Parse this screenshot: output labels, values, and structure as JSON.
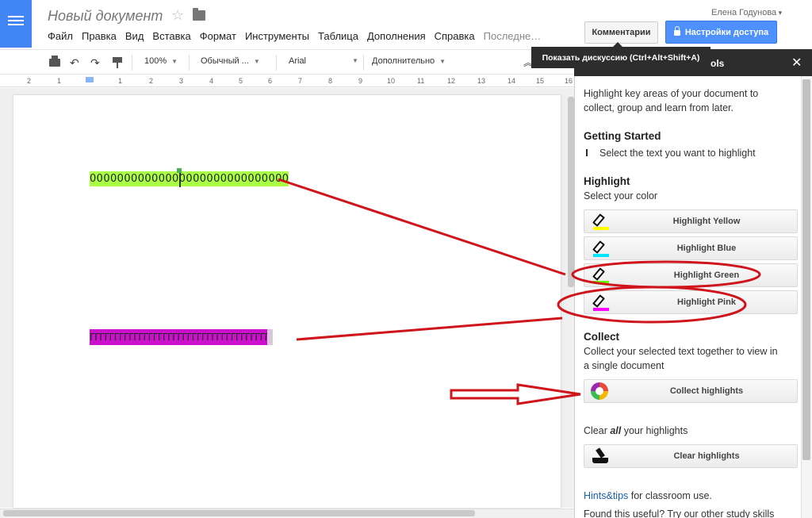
{
  "header": {
    "doc_title": "Новый документ",
    "user_name": "Елена Годунова",
    "comments_button": "Комментарии",
    "share_button": "Настройки доступа"
  },
  "menu": {
    "items": [
      "Файл",
      "Правка",
      "Вид",
      "Вставка",
      "Формат",
      "Инструменты",
      "Таблица",
      "Дополнения",
      "Справка"
    ],
    "recent": "Последне…"
  },
  "toolbar": {
    "zoom": "100%",
    "style": "Обычный ...",
    "font": "Arial",
    "more": "Дополнительно"
  },
  "ruler": {
    "ticks": [
      "2",
      "1",
      "1",
      "2",
      "3",
      "4",
      "5",
      "6",
      "7",
      "8",
      "9",
      "10",
      "11",
      "12",
      "13",
      "14",
      "15",
      "16"
    ]
  },
  "tooltip": {
    "text": "Показать дискуссию (Ctrl+Alt+Shift+A)"
  },
  "document": {
    "line1": "00000000000000000000000000000",
    "line2": "ГГГГГГГГГГГГГГГГГГГГГГГГГГГГГГГГГГГГГГГГГГГГ"
  },
  "sidebar": {
    "title_fragment": "ols",
    "intro_line1": "Highlight key areas of your document to",
    "intro_line2": "collect, group and learn from later.",
    "getting_started_heading": "Getting Started",
    "getting_started_text": "Select the text you want to highlight",
    "highlight_heading": "Highlight",
    "highlight_sub": "Select your color",
    "buttons": [
      {
        "label": "Highlight Yellow",
        "color": "#ffff00"
      },
      {
        "label": "Highlight Blue",
        "color": "#00e5ff"
      },
      {
        "label": "Highlight Green",
        "color": "#66ff00"
      },
      {
        "label": "Highlight Pink",
        "color": "#ff00ff"
      }
    ],
    "collect_heading": "Collect",
    "collect_line1": "Collect your selected text together to view in",
    "collect_line2": "a single document",
    "collect_button": "Collect highlights",
    "clear_prefix": "Clear ",
    "clear_bold": "all",
    "clear_suffix": " your highlights",
    "clear_button": "Clear highlights",
    "hints_link": "Hints&tips",
    "hints_suffix": " for classroom use.",
    "footer": "Found this useful? Try our other study skills"
  },
  "colors": {
    "accent": "#4285f4",
    "annotation": "#d0141c"
  }
}
